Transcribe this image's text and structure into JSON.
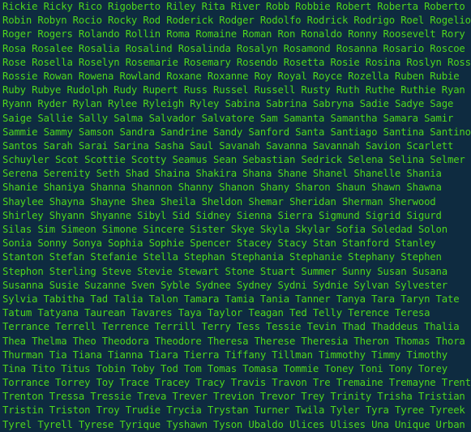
{
  "terminal": {
    "lines": [
      "Rickie Ricky Rico Rigoberto Riley Rita River Robb Robbie Robert Roberta Roberto",
      "Robin Robyn Rocio Rocky Rod Roderick Rodger Rodolfo Rodrick Rodrigo Roel Rogelio",
      "Roger Rogers Rolando Rollin Roma Romaine Roman Ron Ronaldo Ronny Roosevelt Rory",
      "Rosa Rosalee Rosalia Rosalind Rosalinda Rosalyn Rosamond Rosanna Rosario Roscoe",
      "Rose Rosella Roselyn Rosemarie Rosemary Rosendo Rosetta Rosie Rosina Roslyn Ross",
      "Rossie Rowan Rowena Rowland Roxane Roxanne Roy Royal Royce Rozella Ruben Rubie",
      "Ruby Rubye Rudolph Rudy Rupert Russ Russel Russell Rusty Ruth Ruthe Ruthie Ryan",
      "Ryann Ryder Rylan Rylee Ryleigh Ryley Sabina Sabrina Sabryna Sadie Sadye Sage",
      "Saige Sallie Sally Salma Salvador Salvatore Sam Samanta Samantha Samara Samir",
      "Sammie Sammy Samson Sandra Sandrine Sandy Sanford Santa Santiago Santina Santino",
      "Santos Sarah Sarai Sarina Sasha Saul Savanah Savanna Savannah Savion Scarlett",
      "Schuyler Scot Scottie Scotty Seamus Sean Sebastian Sedrick Selena Selina Selmer",
      "Serena Serenity Seth Shad Shaina Shakira Shana Shane Shanel Shanelle Shania",
      "Shanie Shaniya Shanna Shannon Shanny Shanon Shany Sharon Shaun Shawn Shawna",
      "Shaylee Shayna Shayne Shea Sheila Sheldon Shemar Sheridan Sherman Sherwood",
      "Shirley Shyann Shyanne Sibyl Sid Sidney Sienna Sierra Sigmund Sigrid Sigurd",
      "Silas Sim Simeon Simone Sincere Sister Skye Skyla Skylar Sofia Soledad Solon",
      "Sonia Sonny Sonya Sophia Sophie Spencer Stacey Stacy Stan Stanford Stanley",
      "Stanton Stefan Stefanie Stella Stephan Stephania Stephanie Stephany Stephen",
      "Stephon Sterling Steve Stevie Stewart Stone Stuart Summer Sunny Susan Susana",
      "Susanna Susie Suzanne Sven Syble Sydnee Sydney Sydni Sydnie Sylvan Sylvester",
      "Sylvia Tabitha Tad Talia Talon Tamara Tamia Tania Tanner Tanya Tara Taryn Tate",
      "Tatum Tatyana Taurean Tavares Taya Taylor Teagan Ted Telly Terence Teresa",
      "Terrance Terrell Terrence Terrill Terry Tess Tessie Tevin Thad Thaddeus Thalia",
      "Thea Thelma Theo Theodora Theodore Theresa Therese Theresia Theron Thomas Thora",
      "Thurman Tia Tiana Tianna Tiara Tierra Tiffany Tillman Timmothy Timmy Timothy",
      "Tina Tito Titus Tobin Toby Tod Tom Tomas Tomasa Tommie Toney Toni Tony Torey",
      "Torrance Torrey Toy Trace Tracey Tracy Travis Travon Tre Tremaine Tremayne Trent",
      "Trenton Tressa Tressie Treva Trever Trevion Trevor Trey Trinity Trisha Tristian",
      "Tristin Triston Troy Trudie Trycia Trystan Turner Twila Tyler Tyra Tyree Tyreek",
      "Tyrel Tyrell Tyrese Tyrique Tyshawn Tyson Ubaldo Ulices Ulises Una Unique Urban"
    ],
    "colors": {
      "background": "#0e2b40",
      "text": "#4ed61c"
    }
  }
}
